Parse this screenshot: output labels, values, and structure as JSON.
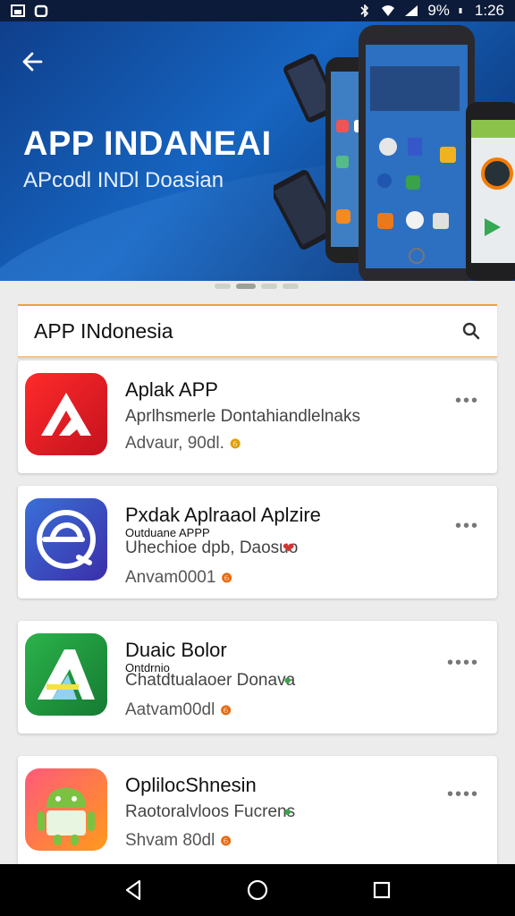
{
  "status_bar": {
    "battery": "9%",
    "time": "1:26"
  },
  "hero": {
    "title": "APP INDANEAI",
    "subtitle": "APcodl INDl Doasian"
  },
  "search": {
    "label": "APP INdonesia"
  },
  "apps": [
    {
      "name": "Aplak APP",
      "tag": "",
      "desc": "Aprlhsmerle Dontahiandlelnaks",
      "meta": "Advaur, 90dl.",
      "badge_color": "#e0a000",
      "more": "•••"
    },
    {
      "name": "Pxdak Aplraaol Aplzire",
      "tag": "Outduane APPP",
      "desc": "Uhechioe dpb, Daosuo",
      "meta": "Anvam0001",
      "badge_color": "#e86a10",
      "more": "•••"
    },
    {
      "name": "Duaic Bolor",
      "tag": "Ontdrnio",
      "desc": "Chatdtualaoer Donava",
      "meta": "Aatvam00dl",
      "badge_color": "#e86a10",
      "more": "••••"
    },
    {
      "name": "OplilocShnesin",
      "tag": "",
      "desc": "Raotoralvloos Fucrens",
      "meta": "Shvam 80dl",
      "badge_color": "#e86a10",
      "more": "••••"
    }
  ],
  "colors": {
    "accent": "#f0a040",
    "hero_blue": "#1665c1"
  }
}
